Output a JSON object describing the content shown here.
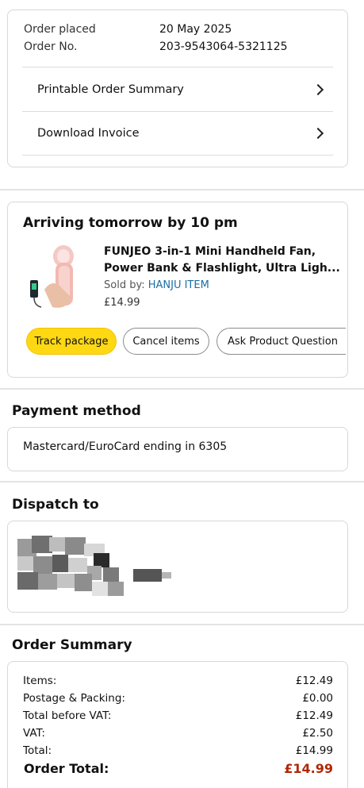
{
  "order_info": {
    "placed_label": "Order placed",
    "placed_value": "20 May 2025",
    "number_label": "Order No.",
    "number_value": "203-9543064-5321125",
    "links": [
      "Printable Order Summary",
      "Download Invoice"
    ]
  },
  "shipment": {
    "heading": "Arriving tomorrow by 10 pm",
    "product_title": "FUNJEO 3-in-1 Mini Handheld Fan, Power Bank & Flashlight, Ultra Ligh...",
    "sold_by_label": "Sold by: ",
    "seller": "HANJU ITEM",
    "price": "£14.99",
    "buttons": {
      "track": "Track package",
      "cancel": "Cancel items",
      "ask": "Ask Product Question"
    }
  },
  "payment": {
    "heading": "Payment method",
    "method": "Mastercard/EuroCard  ending in 6305"
  },
  "dispatch": {
    "heading": "Dispatch to"
  },
  "summary": {
    "heading": "Order Summary",
    "rows": [
      {
        "label": "Items:",
        "value": "£12.49"
      },
      {
        "label": "Postage & Packing:",
        "value": "£0.00"
      },
      {
        "label": "Total before VAT:",
        "value": "£12.49"
      },
      {
        "label": "VAT:",
        "value": "£2.50"
      },
      {
        "label": "Total:",
        "value": "£14.99"
      }
    ],
    "total_label": "Order Total:",
    "total_value": "£14.99",
    "total_color": "#b12704"
  },
  "colors": {
    "accent_button": "#ffd814",
    "link": "#1a6fa8"
  }
}
